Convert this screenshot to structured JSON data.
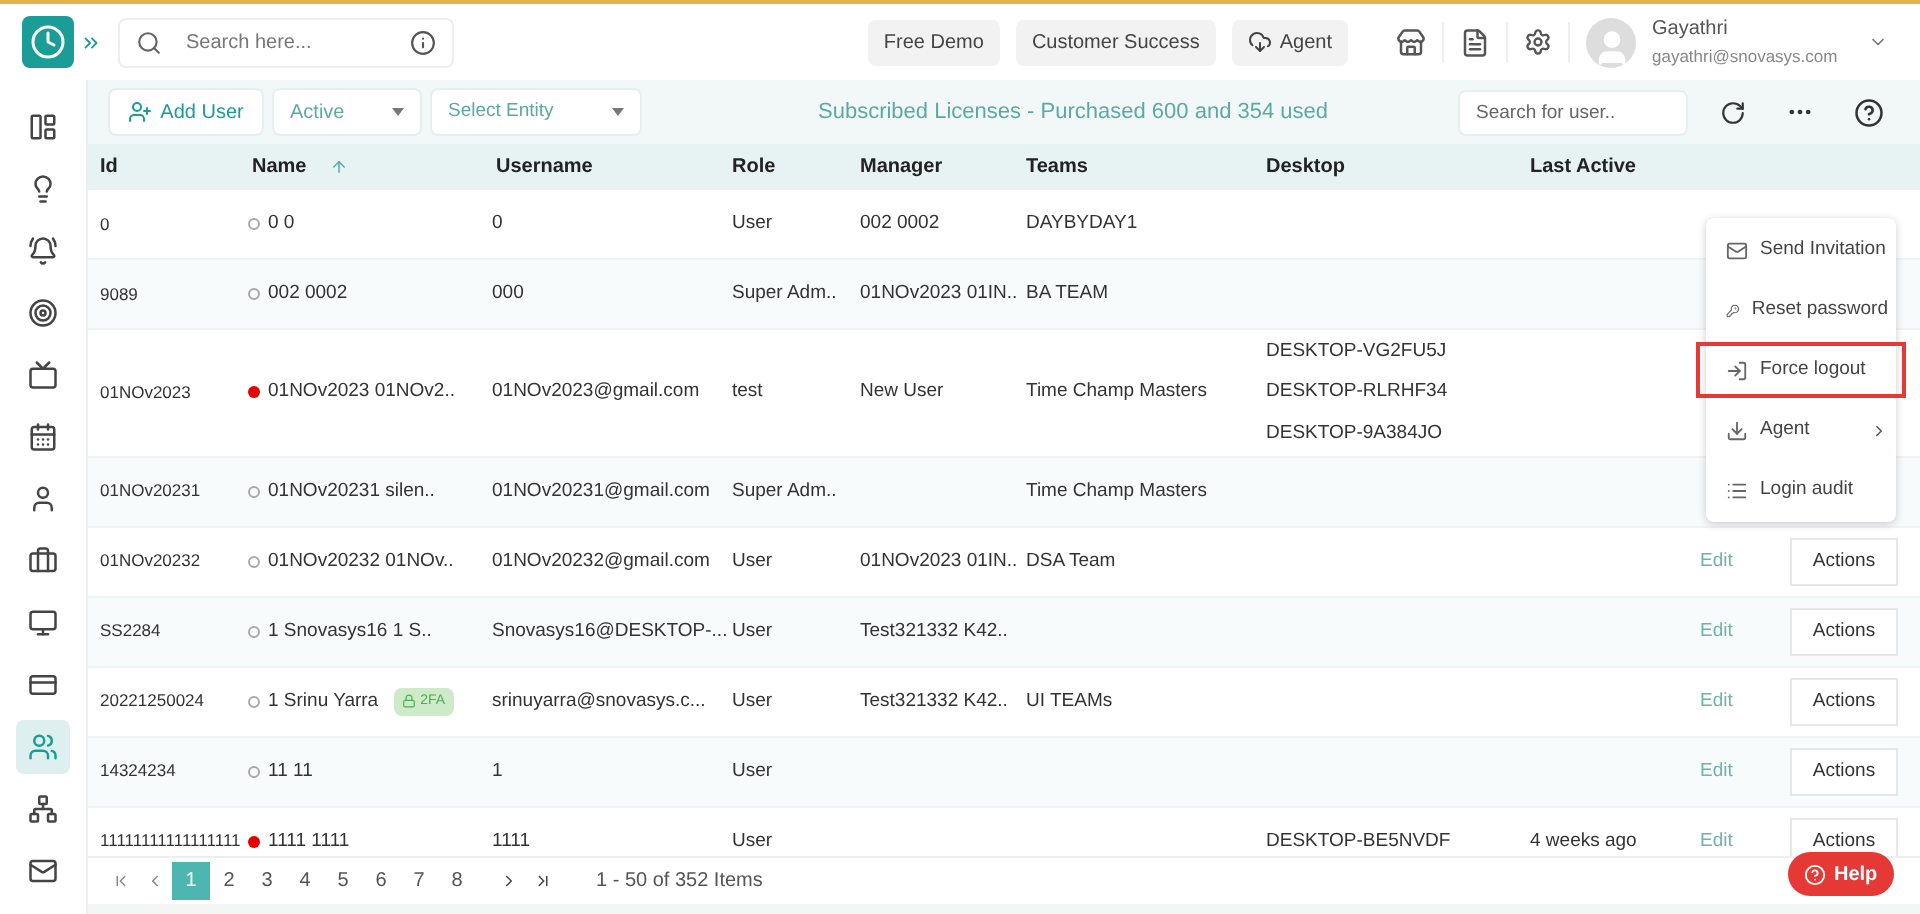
{
  "top_bar": {
    "search": {
      "placeholder": "Search here..."
    },
    "buttons": [
      {
        "label": "Free Demo",
        "kind": "plain"
      },
      {
        "label": "Customer Success",
        "kind": "plain"
      },
      {
        "label": "Agent",
        "kind": "cloud"
      }
    ],
    "user": {
      "name": "Gayathri",
      "email": "gayathri@snovasys.com"
    }
  },
  "sidebar": {
    "items": [
      {
        "selected": false
      },
      {
        "selected": false
      },
      {
        "selected": false
      },
      {
        "selected": false
      },
      {
        "selected": false
      },
      {
        "selected": false
      },
      {
        "selected": false
      },
      {
        "selected": false
      },
      {
        "selected": false
      },
      {
        "selected": false
      },
      {
        "selected": true
      },
      {
        "selected": false
      },
      {
        "selected": false
      }
    ]
  },
  "toolbar": {
    "add_user": "Add User",
    "status_filter": "Active",
    "entity_filter": {
      "placeholder": "Select Entity"
    },
    "license_summary": "Subscribed Licenses - Purchased 600 and 354 used",
    "search": {
      "placeholder": "Search for user.."
    }
  },
  "table": {
    "columns": [
      {
        "label": "Id",
        "sorted": false
      },
      {
        "label": "Name",
        "sorted": true
      },
      {
        "label": "Username",
        "sorted": false
      },
      {
        "label": "Role",
        "sorted": false
      },
      {
        "label": "Manager",
        "sorted": false
      },
      {
        "label": "Teams",
        "sorted": false
      },
      {
        "label": "Desktop",
        "sorted": false
      },
      {
        "label": "Last Active",
        "sorted": false
      }
    ],
    "rows": [
      {
        "id": "0",
        "name": "0 0",
        "online": false,
        "username": "0",
        "role": "User",
        "manager": "002 0002",
        "teams": "DAYBYDAY1"
      },
      {
        "id": "9089",
        "name": "002 0002",
        "online": false,
        "username": "000",
        "role": "Super Adm..",
        "manager": "01NOv2023 01IN..",
        "teams": "BA TEAM"
      },
      {
        "id": "01NOv2023",
        "name": "01NOv2023 01NOv2..",
        "online": true,
        "username": "01NOv2023@gmail.com",
        "role": "test",
        "manager": "New User",
        "teams": "Time Champ Masters",
        "desktops": [
          "DESKTOP-VG2FU5J",
          "DESKTOP-RLRHF34",
          "DESKTOP-9A384JO"
        ]
      },
      {
        "id": "01NOv20231",
        "name": "01NOv20231 silen..",
        "online": false,
        "username": "01NOv20231@gmail.com",
        "role": "Super Adm..",
        "teams": "Time Champ Masters"
      },
      {
        "id": "01NOv20232",
        "name": "01NOv20232 01NOv..",
        "online": false,
        "username": "01NOv20232@gmail.com",
        "role": "User",
        "manager": "01NOv2023 01IN..",
        "teams": "DSA Team",
        "edit": "Edit",
        "actions": "Actions"
      },
      {
        "id": "SS2284",
        "name": "1 Snovasys16 1 S..",
        "online": false,
        "username": "Snovasys16@DESKTOP-...",
        "role": "User",
        "manager": "Test321332 K42..",
        "edit": "Edit",
        "actions": "Actions"
      },
      {
        "id": "20221250024",
        "name": "1 Srinu Yarra",
        "online": false,
        "badge": "2FA",
        "username": "srinuyarra@snovasys.c...",
        "role": "User",
        "manager": "Test321332 K42..",
        "teams": "UI TEAMs",
        "edit": "Edit",
        "actions": "Actions"
      },
      {
        "id": "14324234",
        "name": "11 11",
        "online": false,
        "username": "1",
        "role": "User",
        "edit": "Edit",
        "actions": "Actions"
      },
      {
        "id": "11111111111111111",
        "name": "1111 1111",
        "online": true,
        "username": "1111",
        "role": "User",
        "desktops": [
          "DESKTOP-BE5NVDF"
        ],
        "last_active": "4 weeks ago",
        "edit": "Edit",
        "actions": "Actions"
      }
    ]
  },
  "action_menu": {
    "items": [
      {
        "label": "Send Invitation",
        "kind": "mail",
        "submenu": false,
        "selected": false
      },
      {
        "label": "Reset password",
        "kind": "key",
        "submenu": false,
        "selected": false
      },
      {
        "label": "Force logout",
        "kind": "logout",
        "submenu": false,
        "selected": true
      },
      {
        "label": "Agent",
        "kind": "download",
        "submenu": true,
        "selected": false
      },
      {
        "label": "Login audit",
        "kind": "list",
        "submenu": false,
        "selected": false
      }
    ]
  },
  "pagination": {
    "pages": [
      {
        "label": "1",
        "selected": true
      },
      {
        "label": "2",
        "selected": false
      },
      {
        "label": "3",
        "selected": false
      },
      {
        "label": "4",
        "selected": false
      },
      {
        "label": "5",
        "selected": false
      },
      {
        "label": "6",
        "selected": false
      },
      {
        "label": "7",
        "selected": false
      },
      {
        "label": "8",
        "selected": false
      }
    ],
    "summary": "1 - 50 of 352 Items"
  },
  "help_button": "Help"
}
